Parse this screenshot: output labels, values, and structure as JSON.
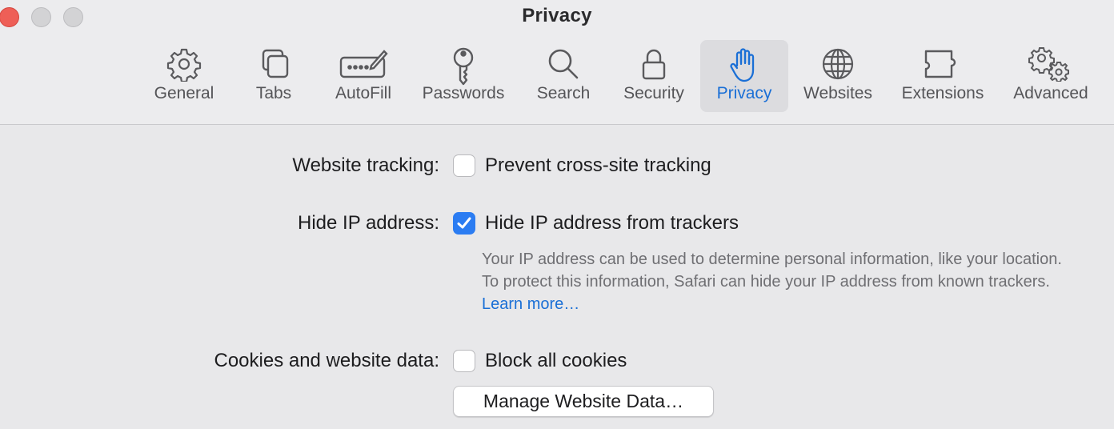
{
  "window": {
    "title": "Privacy"
  },
  "toolbar": {
    "tabs": [
      {
        "label": "General",
        "icon": "gear-icon"
      },
      {
        "label": "Tabs",
        "icon": "tabs-icon"
      },
      {
        "label": "AutoFill",
        "icon": "autofill-icon"
      },
      {
        "label": "Passwords",
        "icon": "key-icon"
      },
      {
        "label": "Search",
        "icon": "search-icon"
      },
      {
        "label": "Security",
        "icon": "lock-icon"
      },
      {
        "label": "Privacy",
        "icon": "hand-icon",
        "selected": true
      },
      {
        "label": "Websites",
        "icon": "globe-icon"
      },
      {
        "label": "Extensions",
        "icon": "puzzle-icon"
      },
      {
        "label": "Advanced",
        "icon": "gears-icon"
      }
    ]
  },
  "settings": {
    "tracking": {
      "label": "Website tracking:",
      "option": "Prevent cross-site tracking",
      "checked": false
    },
    "hide_ip": {
      "label": "Hide IP address:",
      "option": "Hide IP address from trackers",
      "checked": true,
      "description": "Your IP address can be used to determine personal information, like your location. To protect this information, Safari can hide your IP address from known trackers.",
      "link": "Learn more…"
    },
    "cookies": {
      "label": "Cookies and website data:",
      "option": "Block all cookies",
      "checked": false
    },
    "manage_button": "Manage Website Data…"
  },
  "colors": {
    "accent": "#1a6fd6",
    "checkbox_checked": "#2b7cf2",
    "close": "#ee5f57"
  }
}
